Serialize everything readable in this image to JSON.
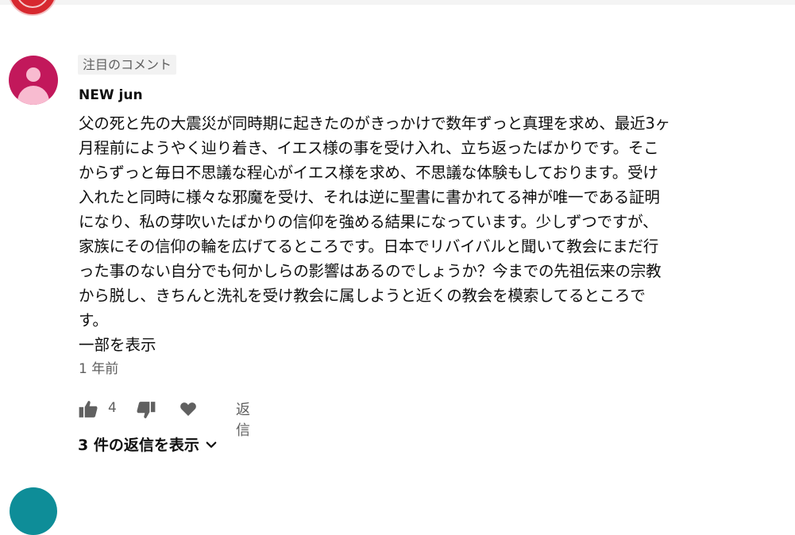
{
  "comment": {
    "pinned_label": "注目のコメント",
    "author": "NEW jun",
    "text_lines": [
      "父の死と先の大震災が同時期に起きたのがきっかけで数年ずっと真理を求め、最近3ヶ",
      "月程前にようやく辿り着き、イエス様の事を受け入れ、立ち返ったばかりです。そこ",
      "からずっと毎日不思議な程心がイエス様を求め、不思議な体験もしております。受け",
      "入れたと同時に様々な邪魔を受け、それは逆に聖書に書かれてる神が唯一である証明",
      "になり、私の芽吹いたばかりの信仰を強める結果になっています。少しずつですが、",
      "家族にその信仰の輪を広げてるところです。日本でリバイバルと聞いて教会にまだ行",
      "った事のない自分でも何かしらの影響はあるのでしょうか？今までの先祖伝来の宗教",
      "から脱し、きちんと洗礼を受け教会に属しようと近くの教会を模索してるところで",
      "す。"
    ],
    "show_part_label": "一部を表示",
    "timestamp": "1 年前",
    "like_count": "4",
    "reply_label": "返信",
    "view_replies_label": "3 件の返信を表示",
    "avatar_color": "#c2185b"
  }
}
